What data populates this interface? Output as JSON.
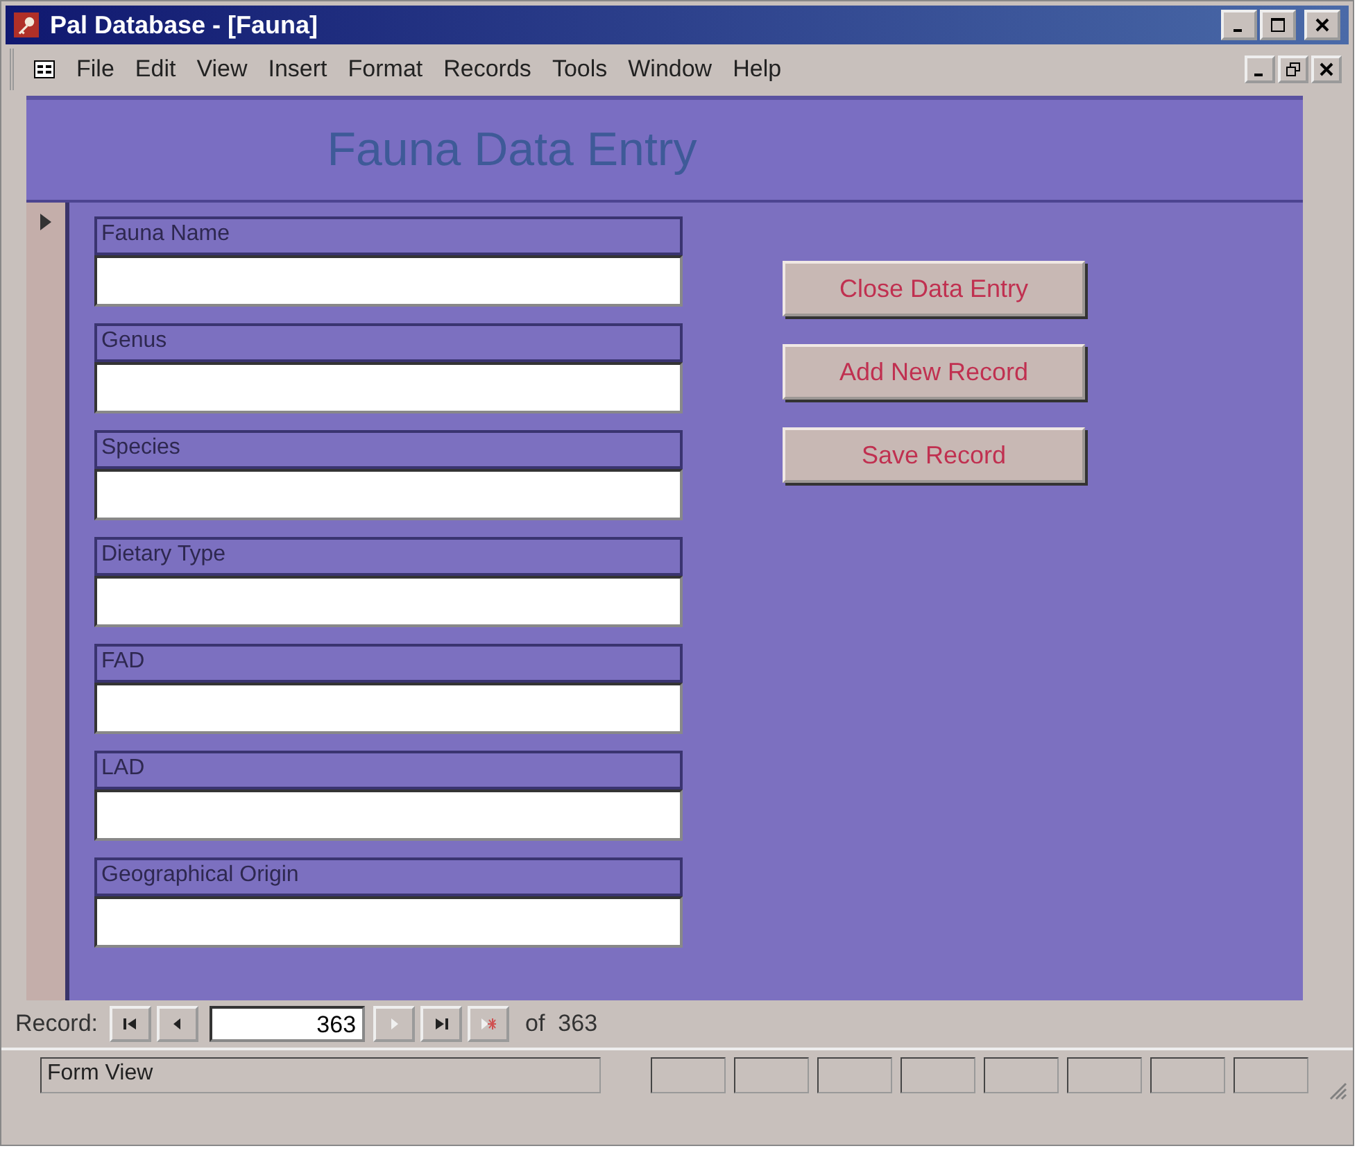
{
  "window": {
    "title": "Pal Database - [Fauna]"
  },
  "menu": [
    "File",
    "Edit",
    "View",
    "Insert",
    "Format",
    "Records",
    "Tools",
    "Window",
    "Help"
  ],
  "form": {
    "title": "Fauna Data Entry",
    "fields": [
      {
        "label": "Fauna Name"
      },
      {
        "label": "Genus"
      },
      {
        "label": "Species"
      },
      {
        "label": "Dietary Type"
      },
      {
        "label": "FAD"
      },
      {
        "label": "LAD"
      },
      {
        "label": "Geographical Origin"
      }
    ],
    "buttons": [
      "Close Data Entry",
      "Add New Record",
      "Save Record"
    ]
  },
  "navigator": {
    "label": "Record:",
    "current": "363",
    "total": "of  363",
    "buttons": [
      {
        "kind": "first",
        "disabled": false
      },
      {
        "kind": "prev",
        "disabled": false
      },
      {
        "kind": "next",
        "disabled": true
      },
      {
        "kind": "last",
        "disabled": false
      },
      {
        "kind": "new",
        "disabled": true
      }
    ]
  },
  "status_bar": {
    "text": "Form View"
  }
}
